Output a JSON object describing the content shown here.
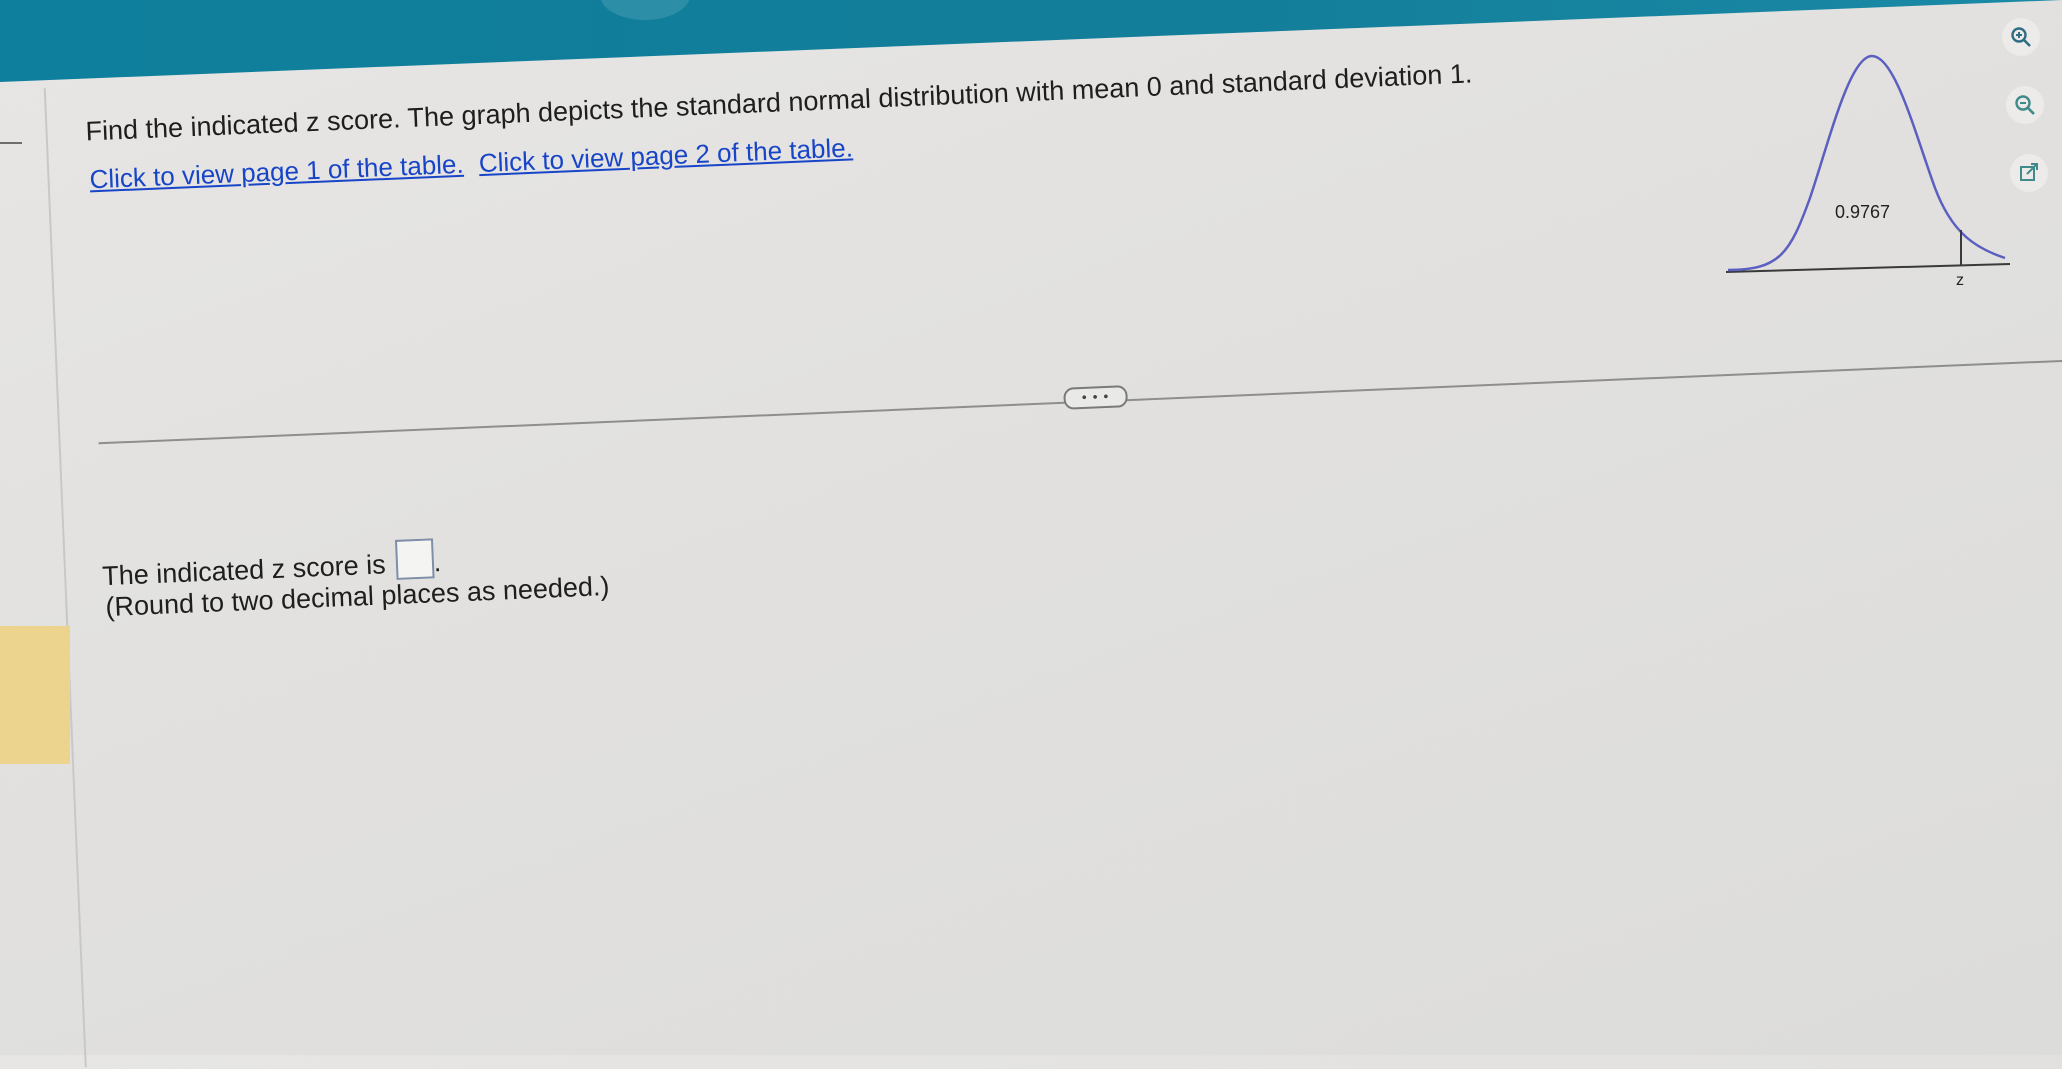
{
  "question": {
    "prompt": "Find the indicated z score. The graph depicts the standard normal distribution with mean 0 and standard deviation 1.",
    "links": [
      "Click to view page 1 of the table.",
      "Click to view page 2 of the table."
    ]
  },
  "graph": {
    "area_label": "0.9767",
    "z_label": "z"
  },
  "more_button": "• • •",
  "answer": {
    "prefix": "The indicated z score is",
    "value": "",
    "suffix": ".",
    "note": "(Round to two decimal places as needed.)"
  },
  "toolbar": {
    "icons": [
      "zoom-in-icon",
      "zoom-out-icon",
      "open-external-icon"
    ]
  },
  "colors": {
    "header": "#0e7f9c",
    "link": "#1845c8",
    "curve": "#5b5fc0"
  }
}
